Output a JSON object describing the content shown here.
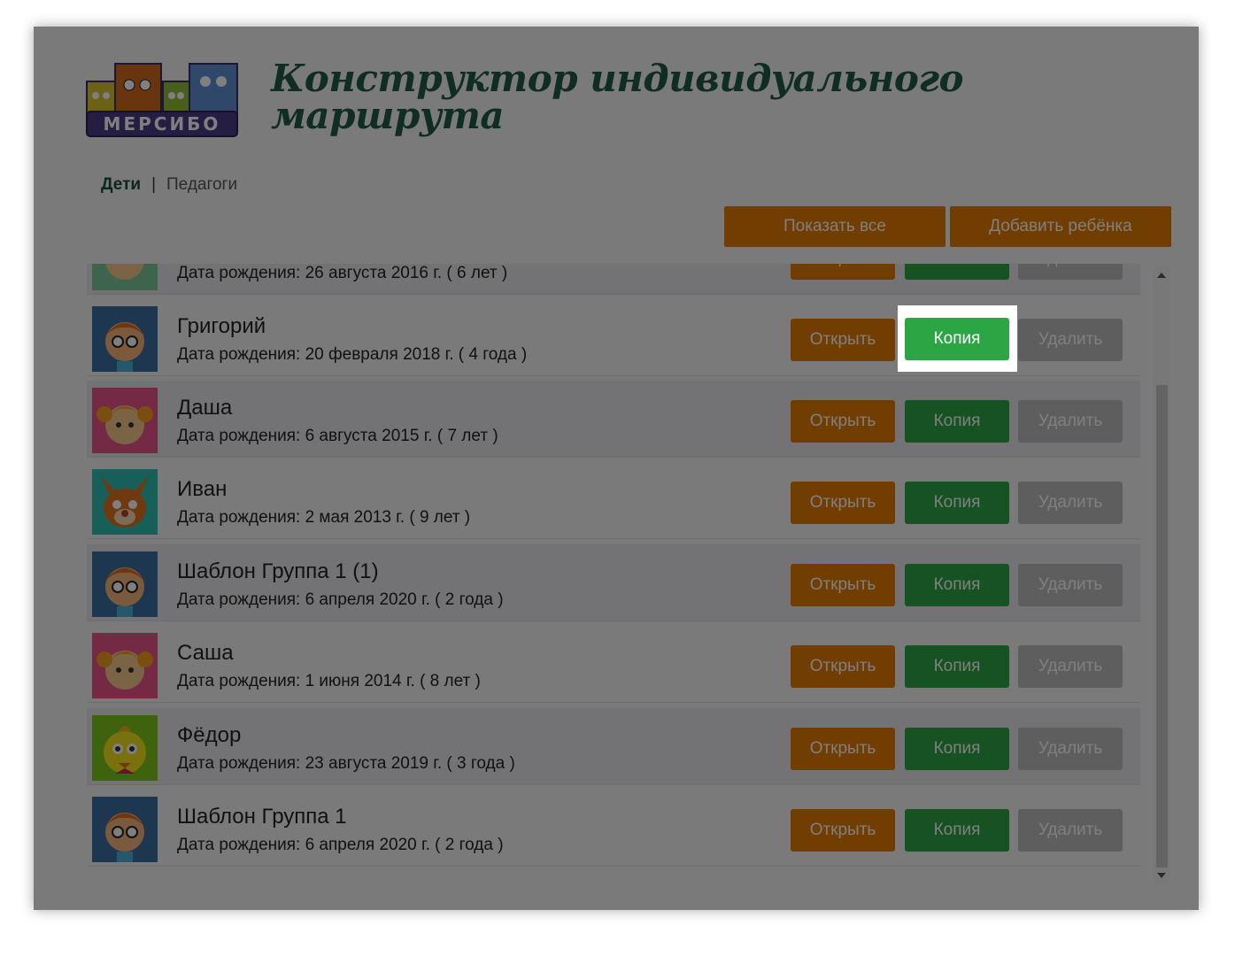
{
  "header": {
    "logo_text": "МЕРСИБО",
    "title_line1": "Конструктор индивидуального",
    "title_line2": "маршрута"
  },
  "nav": {
    "tab_children": "Дети",
    "separator": "|",
    "tab_teachers": "Педагоги"
  },
  "toolbar": {
    "show_all": "Показать все",
    "add_child": "Добавить ребёнка"
  },
  "labels": {
    "open": "Открыть",
    "copy": "Копия",
    "delete": "Удалить"
  },
  "children": [
    {
      "name": "",
      "dob": "Дата рождения: 26 августа 2016 г. ( 6 лет )",
      "avatar": "girl-blonde"
    },
    {
      "name": "Григорий",
      "dob": "Дата рождения: 20 февраля 2018 г. ( 4 года )",
      "avatar": "boy-glasses"
    },
    {
      "name": "Даша",
      "dob": "Дата рождения: 6 августа 2015 г. ( 7 лет )",
      "avatar": "girl-pigtails"
    },
    {
      "name": "Иван",
      "dob": "Дата рождения: 2 мая 2013 г. ( 9 лет )",
      "avatar": "fox"
    },
    {
      "name": "Шаблон Группа 1 (1)",
      "dob": "Дата рождения: 6 апреля 2020 г. ( 2 года )",
      "avatar": "boy-glasses"
    },
    {
      "name": "Саша",
      "dob": "Дата рождения: 1 июня 2014 г. ( 8 лет )",
      "avatar": "girl-pigtails"
    },
    {
      "name": "Фёдор",
      "dob": "Дата рождения: 23 августа 2019 г. ( 3 года )",
      "avatar": "yellow-bird"
    },
    {
      "name": "Шаблон Группа 1",
      "dob": "Дата рождения: 6 апреля 2020 г. ( 2 года )",
      "avatar": "boy-glasses"
    }
  ],
  "colors": {
    "orange": "#e37b00",
    "green": "#2ca545",
    "gray": "#bdbdbd",
    "title": "#1f5a44"
  }
}
